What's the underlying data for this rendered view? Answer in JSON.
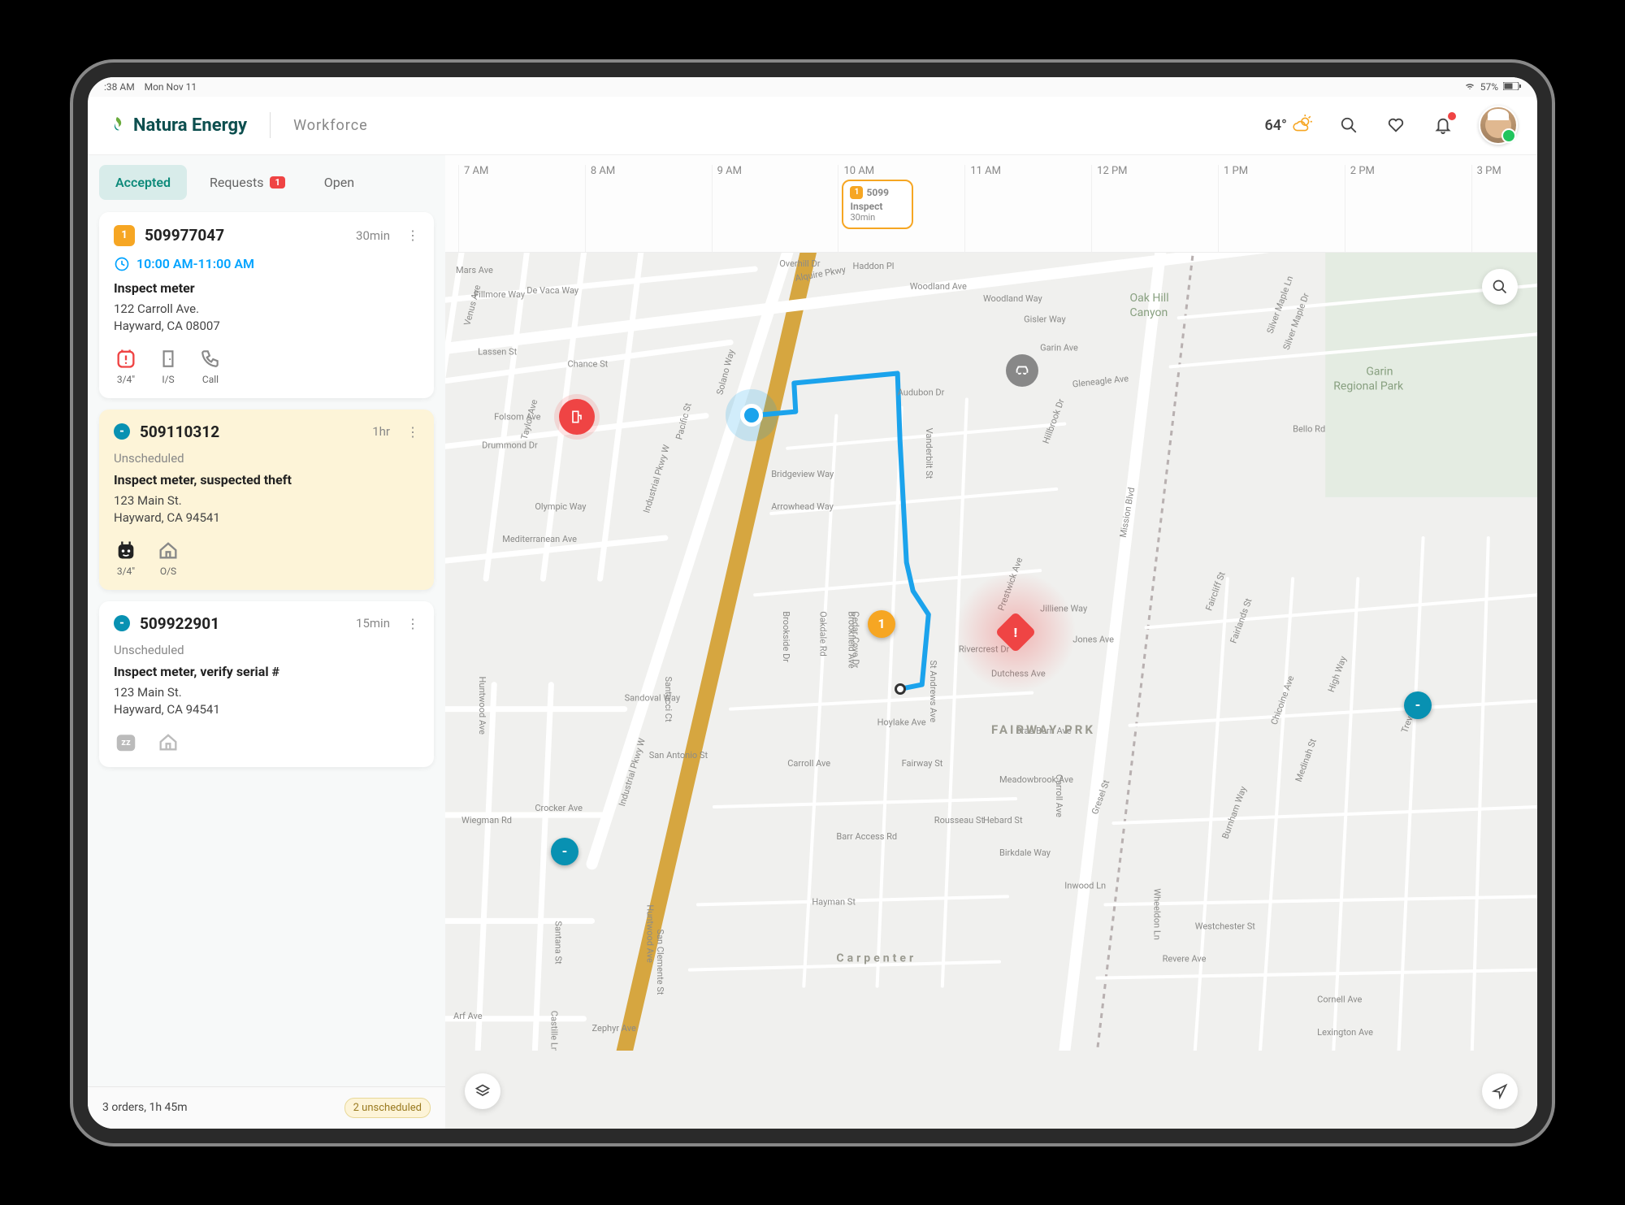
{
  "statusbar": {
    "time": ":38 AM",
    "date": "Mon Nov 11",
    "battery": "57%"
  },
  "header": {
    "brand": "Natura Energy",
    "section": "Workforce",
    "temp": "64°"
  },
  "tabs": {
    "accepted": "Accepted",
    "requests": "Requests",
    "requests_badge": "1",
    "open": "Open"
  },
  "timeline": {
    "hours": [
      "7 AM",
      "8 AM",
      "9 AM",
      "10 AM",
      "11 AM",
      "12 PM",
      "1 PM",
      "2 PM",
      "3 PM"
    ],
    "card": {
      "badge": "1",
      "id_short": "5099",
      "task": "Inspect",
      "duration": "30min"
    }
  },
  "orders": [
    {
      "badge_type": "orange",
      "badge": "1",
      "id": "509977047",
      "duration": "30min",
      "time": "10:00 AM-11:00 AM",
      "task": "Inspect meter",
      "addr1": "122 Carroll Ave.",
      "addr2": "Hayward, CA 08007",
      "actions": [
        {
          "icon": "alert",
          "label": "3/4\""
        },
        {
          "icon": "indoor",
          "label": "I/S"
        },
        {
          "icon": "phone",
          "label": "Call"
        }
      ]
    },
    {
      "badge_type": "blue-dot",
      "badge": "-",
      "id": "509110312",
      "duration": "1hr",
      "unscheduled": "Unscheduled",
      "task": "Inspect meter, suspected theft",
      "addr1": "123 Main St.",
      "addr2": "Hayward, CA 94541",
      "actions": [
        {
          "icon": "meter-dark",
          "label": "3/4\""
        },
        {
          "icon": "house",
          "label": "O/S"
        }
      ]
    },
    {
      "badge_type": "blue-dot",
      "badge": "-",
      "id": "509922901",
      "duration": "15min",
      "unscheduled": "Unscheduled",
      "task": "Inspect meter, verify serial #",
      "addr1": "123 Main St.",
      "addr2": "Hayward, CA 94541",
      "actions": [
        {
          "icon": "sleep",
          "label": ""
        },
        {
          "icon": "house",
          "label": ""
        }
      ]
    }
  ],
  "footer": {
    "summary": "3 orders, 1h 45m",
    "chip": "2 unscheduled"
  },
  "map": {
    "areas": {
      "fairway": "FAIRWAY PRK",
      "oakhill": "Oak Hill\nCanyon",
      "garin": "Garin\nRegional Park",
      "carpenter": "Carpenter"
    },
    "streets": [
      "Industrial Pkwy W",
      "Mission Blvd",
      "Huntwood Ave",
      "Garin Ave",
      "Gleneagle Ave",
      "Gisler Way",
      "Woodland Ave",
      "Woodland Way",
      "Hoylake Ave",
      "St Andrews Ave",
      "Fairway St",
      "Carroll Ave",
      "Rivercrest Dr",
      "Prestwick Ave",
      "Jilliene Way",
      "Brae Burn Ave",
      "Meadowbrook Ave",
      "Hebard St",
      "Birkdale Way",
      "Carroll Ave",
      "Olympic Way",
      "Mediterranean Ave",
      "Sandoval Way",
      "San Antonio St",
      "Crocker Ave",
      "Wiegman Rd",
      "Santana St",
      "San Clemente St",
      "Zephyr Ave",
      "Hayman St",
      "Barr Access Rd",
      "Inwood Ln",
      "Wheeldon Ln",
      "Rousseau St",
      "Cornell Ave",
      "Lexington Ave",
      "Revere Ave",
      "Westchester St",
      "Burnham Way",
      "Gresel St",
      "Medinah St",
      "Chicoine Ave",
      "High Way",
      "Trevor Ave",
      "Faircliff St",
      "Fairlands St",
      "Jones Ave",
      "Fillmore Way",
      "De Vaca Way",
      "Lassen St",
      "Chance St",
      "Drummond Dr",
      "Folsom Ave",
      "Taylor Ave",
      "Pacific St",
      "Solano Way",
      "Bridgeview Way",
      "Arrowhead Way",
      "Oakdale Rd",
      "Brookside Dr",
      "Brookfield Ave",
      "Audubon Dr",
      "Vanderbilt St",
      "Alquire Pkwy",
      "Overhill Dr",
      "Haddon Pl",
      "Mars Ave",
      "Venus Ave",
      "Cedar Cove Dr",
      "Dutchess Ave",
      "Hillbrook Dr",
      "Bello Rd",
      "Silver Maple Ln",
      "Silver Maple Dr",
      "Santucci Ct",
      "Castille Ln",
      "Arf Ave"
    ],
    "marker_labels": {
      "orange": "1"
    }
  }
}
